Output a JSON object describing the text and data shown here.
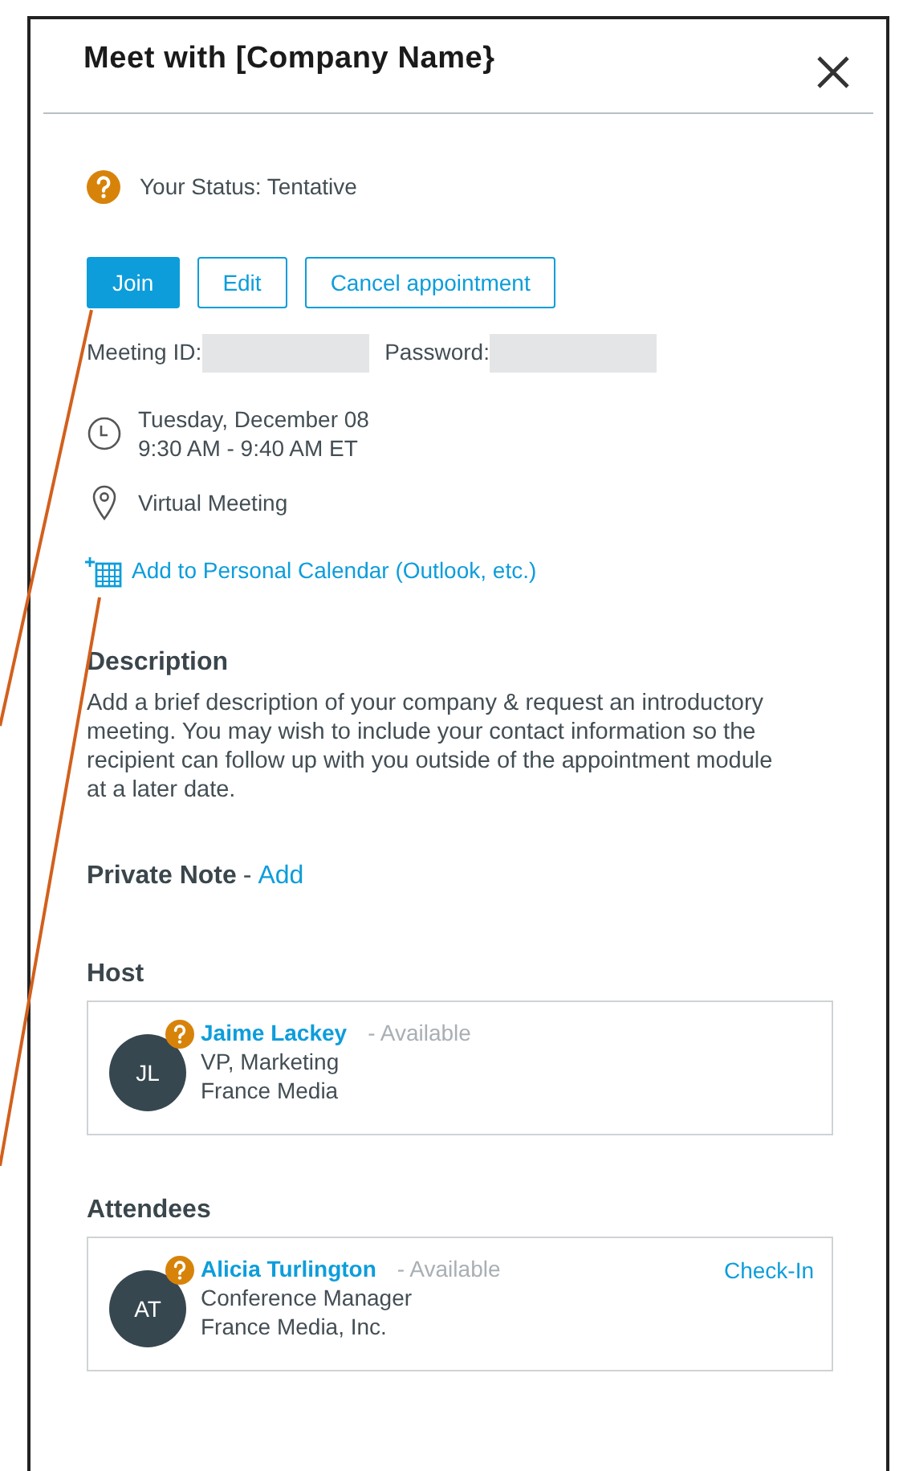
{
  "dialog": {
    "title": "Meet with [Company Name}"
  },
  "status": {
    "label": "Your Status: Tentative"
  },
  "buttons": [
    {
      "label": "Join",
      "kind": "primary"
    },
    {
      "label": "Edit",
      "kind": "outline"
    },
    {
      "label": "Cancel appointment",
      "kind": "outline"
    }
  ],
  "credentials": [
    {
      "label": "Meeting ID:"
    },
    {
      "label": "Password:"
    }
  ],
  "schedule": {
    "date": "Tuesday, December 08",
    "time": "9:30 AM - 9:40 AM ET"
  },
  "location": "Virtual Meeting",
  "calendar_link": "Add to Personal Calendar (Outlook, etc.)",
  "description": {
    "heading": "Description",
    "text": "Add a brief description of your company & request an introductory meeting. You may wish to include your contact information so the recipient can follow up with you outside of the appointment module at a later date."
  },
  "private_note": {
    "label": "Private Note",
    "separator": "-",
    "action": "Add"
  },
  "sections": [
    {
      "heading": "Host",
      "people": [
        {
          "initials": "JL",
          "name": "Jaime Lackey",
          "availability": "- Available",
          "title": "VP, Marketing",
          "company": "France Media"
        }
      ]
    },
    {
      "heading": "Attendees",
      "people": [
        {
          "initials": "AT",
          "name": "Alicia Turlington",
          "availability": "- Available",
          "title": "Conference Manager",
          "company": "France Media, Inc.",
          "action": "Check-In"
        }
      ]
    }
  ]
}
